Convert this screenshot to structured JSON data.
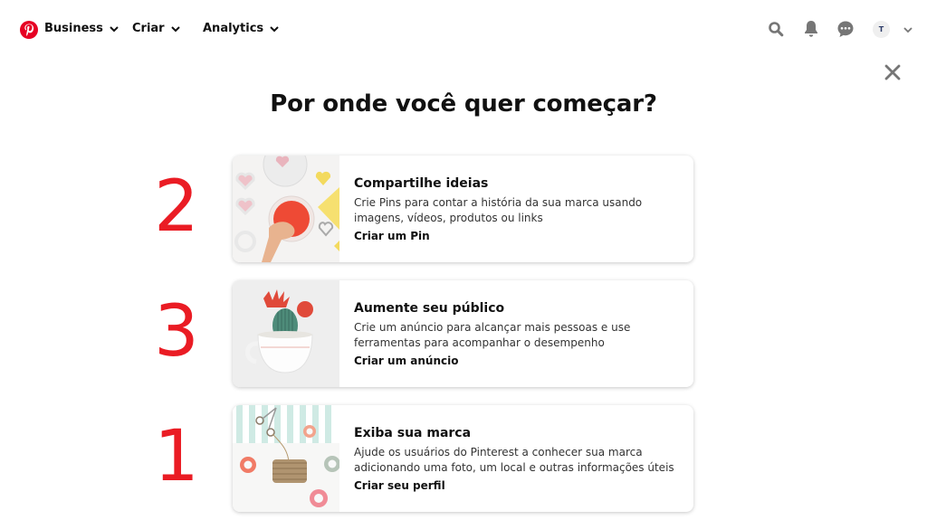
{
  "header": {
    "logo": "pinterest-logo",
    "nav": [
      {
        "label": "Business",
        "icon": "chevron-down-icon"
      },
      {
        "label": "Criar",
        "icon": "chevron-down-icon"
      },
      {
        "label": "Analytics",
        "icon": "chevron-down-icon"
      }
    ],
    "icons": [
      "search-icon",
      "bell-icon",
      "chat-icon"
    ],
    "avatar_initial": "T"
  },
  "page": {
    "title": "Por onde você quer começar?",
    "close_icon": "close-icon"
  },
  "cards": [
    {
      "title": "Compartilhe ideias",
      "description": "Crie Pins para contar a história da sua marca usando imagens, vídeos, produtos ou links",
      "link": "Criar um Pin",
      "image": "baking-hearts-photo"
    },
    {
      "title": "Aumente seu público",
      "description": "Crie um anúncio para alcançar mais pessoas e use ferramentas para acompanhar o desempenho",
      "link": "Criar um anúncio",
      "image": "cactus-cup-photo"
    },
    {
      "title": "Exiba sua marca",
      "description": "Ajude os usuários do Pinterest a conhecer sua marca adicionando uma foto, um local e outras informações úteis",
      "link": "Criar seu perfil",
      "image": "twine-tape-photo"
    }
  ],
  "annotations": [
    "2",
    "3",
    "1"
  ],
  "colors": {
    "brand": "#e60023",
    "annotation": "#ea1c24",
    "icon_gray": "#767676"
  }
}
